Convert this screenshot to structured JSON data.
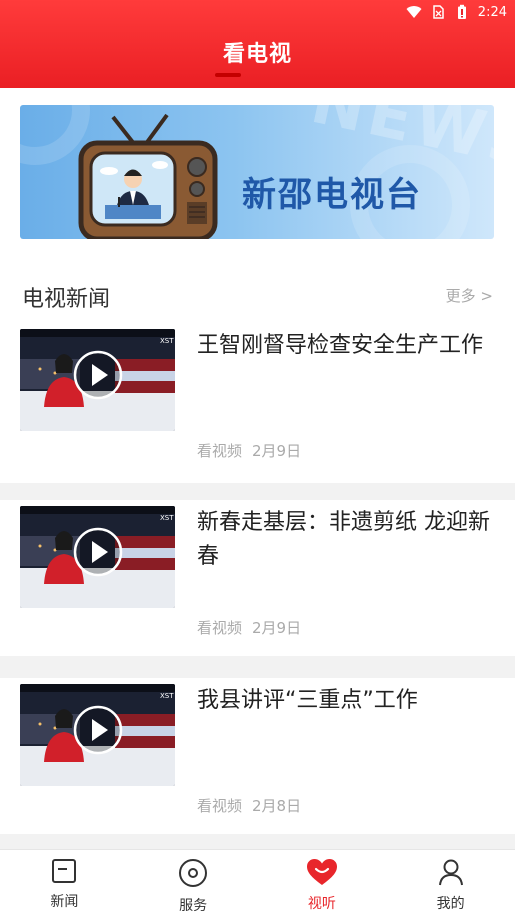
{
  "status_bar": {
    "time": "2:24"
  },
  "header": {
    "title": "看电视"
  },
  "banner": {
    "text": "新邵电视台",
    "watermark": "NEWS"
  },
  "section": {
    "title": "电视新闻",
    "more_label": "更多 >"
  },
  "news": [
    {
      "title": "王智刚督导检查安全生产工作",
      "source": "看视频",
      "date": "2月9日"
    },
    {
      "title": "新春走基层：非遗剪纸 龙迎新春",
      "source": "看视频",
      "date": "2月9日"
    },
    {
      "title": "我县讲评“三重点”工作",
      "source": "看视频",
      "date": "2月8日"
    }
  ],
  "bottom_nav": [
    {
      "label": "新闻",
      "icon": "news-icon",
      "active": false
    },
    {
      "label": "服务",
      "icon": "service-icon",
      "active": false
    },
    {
      "label": "视听",
      "icon": "heart-smile-icon",
      "active": true
    },
    {
      "label": "我的",
      "icon": "user-icon",
      "active": false
    }
  ],
  "colors": {
    "accent": "#e8262b",
    "header": "#ff3b3b",
    "banner_text": "#1f58a8"
  }
}
